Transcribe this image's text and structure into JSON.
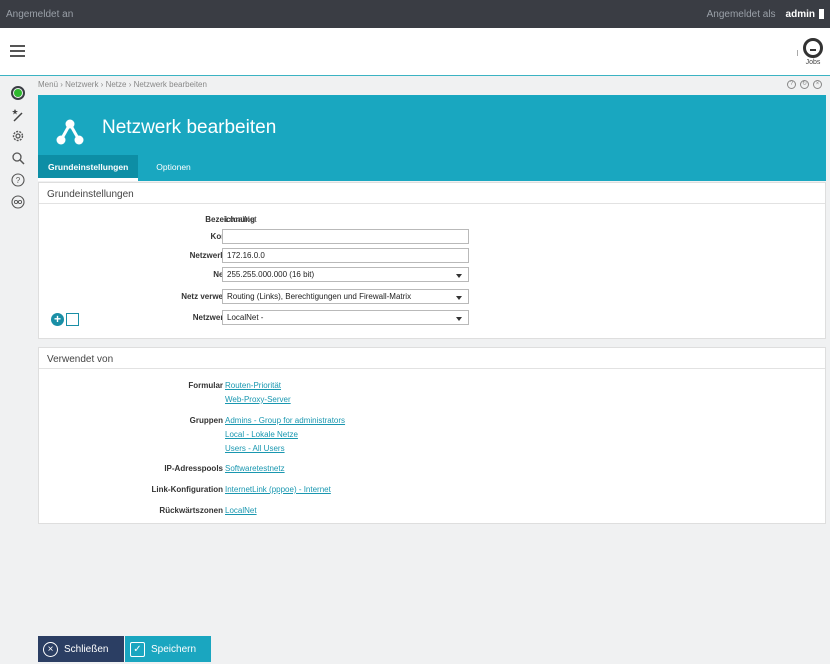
{
  "topbar": {
    "left_text": "Angemeldet an",
    "logged_in_as": "Angemeldet als",
    "user": "admin"
  },
  "header": {
    "jobs_label": "Jobs"
  },
  "breadcrumb": "Menü › Netzwerk › Netze › Netzwerk bearbeiten",
  "hero": {
    "title": "Netzwerk bearbeiten"
  },
  "tabs": [
    {
      "label": "Grundeinstellungen"
    },
    {
      "label": "Optionen"
    }
  ],
  "settings": {
    "title": "Grundeinstellungen",
    "bezeichnung_label": "Bezeichnung",
    "bezeichnung_value": "LocalNet",
    "kommentar_label": "Kommentar",
    "kommentar_value": "",
    "adresse_label": "Netzwerkadresse",
    "adresse_value": "172.16.0.0",
    "maske_label": "Netzmaske",
    "maske_value": "255.255.000.000 (16 bit)",
    "verwenden_label": "Netz verwenden für",
    "verwenden_value": "Routing (Links), Berechtigungen und Firewall-Matrix",
    "gruppe_label": "Netzwerkgruppe",
    "gruppe_value": "LocalNet -"
  },
  "used_by": {
    "title": "Verwendet von",
    "formular_label": "Formular",
    "formular_links": [
      "Routen-Priorität",
      "Web-Proxy-Server"
    ],
    "gruppen_label": "Gruppen",
    "gruppen_links": [
      "Admins - Group for administrators",
      "Local - Lokale Netze",
      "Users - All Users"
    ],
    "pools_label": "IP-Adresspools",
    "pools_links": [
      "Softwaretestnetz"
    ],
    "link_label": "Link-Konfiguration",
    "link_links": [
      "InternetLink (pppoe) - Internet"
    ],
    "zonen_label": "Rückwärtszonen",
    "zonen_links": [
      "LocalNet"
    ]
  },
  "buttons": {
    "close": "Schließen",
    "save": "Speichern"
  },
  "colors": {
    "accent": "#19a7c0",
    "dark": "#3a3d44",
    "close_button": "#2b3e63",
    "link": "#1997b0"
  }
}
